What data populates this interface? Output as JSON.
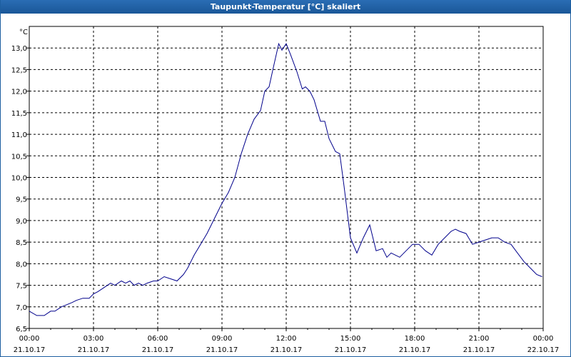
{
  "window": {
    "title": "Taupunkt-Temperatur [°C] skaliert"
  },
  "chart_data": {
    "type": "line",
    "title": "Taupunkt-Temperatur [°C] skaliert",
    "ylabel": "°C",
    "xlabel": "",
    "ylim": [
      6.5,
      13.5
    ],
    "xlim": [
      0,
      24
    ],
    "y_ticks": [
      "6,5",
      "7,0",
      "7,5",
      "8,0",
      "8,5",
      "9,0",
      "9,5",
      "10,0",
      "10,5",
      "11,0",
      "11,5",
      "12,0",
      "12,5",
      "13,0"
    ],
    "x_ticks": [
      {
        "time": "00:00",
        "date": "21.10.17"
      },
      {
        "time": "03:00",
        "date": "21.10.17"
      },
      {
        "time": "06:00",
        "date": "21.10.17"
      },
      {
        "time": "09:00",
        "date": "21.10.17"
      },
      {
        "time": "12:00",
        "date": "21.10.17"
      },
      {
        "time": "15:00",
        "date": "21.10.17"
      },
      {
        "time": "18:00",
        "date": "21.10.17"
      },
      {
        "time": "21:00",
        "date": "21.10.17"
      },
      {
        "time": "00:00",
        "date": "22.10.17"
      }
    ],
    "grid": true,
    "line_color": "#00008b",
    "series": [
      {
        "x": [
          0,
          0.35,
          0.7,
          1,
          1.2,
          1.5,
          2,
          2.2,
          2.5,
          2.8,
          3,
          3.2,
          3.5,
          3.8,
          4,
          4.3,
          4.5,
          4.7,
          4.9,
          5.1,
          5.3,
          5.5,
          5.8,
          6,
          6.3,
          6.6,
          6.9,
          7.2,
          7.4,
          7.7,
          8,
          8.3,
          8.7,
          9,
          9.3,
          9.6,
          9.9,
          10.2,
          10.5,
          10.8,
          11,
          11.2,
          11.4,
          11.65,
          11.8,
          12,
          12.2,
          12.5,
          12.75,
          12.9,
          13.1,
          13.3,
          13.6,
          13.8,
          14,
          14.3,
          14.5,
          14.7,
          14.85,
          15,
          15.3,
          15.6,
          15.9,
          16.2,
          16.5,
          16.7,
          16.9,
          17.1,
          17.3,
          17.6,
          17.9,
          18.2,
          18.5,
          18.8,
          19.1,
          19.4,
          19.7,
          19.9,
          20.1,
          20.4,
          20.7,
          21,
          21.3,
          21.6,
          21.9,
          22.2,
          22.5,
          22.8,
          23.1,
          23.4,
          23.7,
          23.95
        ],
        "values": [
          6.9,
          6.8,
          6.8,
          6.9,
          6.9,
          7.0,
          7.1,
          7.15,
          7.2,
          7.2,
          7.3,
          7.35,
          7.45,
          7.55,
          7.5,
          7.6,
          7.55,
          7.6,
          7.5,
          7.55,
          7.5,
          7.55,
          7.6,
          7.6,
          7.7,
          7.65,
          7.6,
          7.75,
          7.9,
          8.2,
          8.45,
          8.7,
          9.1,
          9.4,
          9.65,
          10.0,
          10.55,
          11.0,
          11.35,
          11.55,
          12.0,
          12.1,
          12.55,
          13.1,
          12.95,
          13.1,
          12.85,
          12.45,
          12.05,
          12.1,
          12.0,
          11.8,
          11.3,
          11.3,
          10.9,
          10.6,
          10.55,
          9.8,
          9.2,
          8.6,
          8.25,
          8.6,
          8.9,
          8.3,
          8.35,
          8.15,
          8.25,
          8.2,
          8.15,
          8.3,
          8.45,
          8.45,
          8.3,
          8.2,
          8.45,
          8.6,
          8.75,
          8.8,
          8.75,
          8.7,
          8.45,
          8.5,
          8.55,
          8.6,
          8.6,
          8.5,
          8.45,
          8.25,
          8.05,
          7.9,
          7.75,
          7.7
        ]
      }
    ]
  }
}
